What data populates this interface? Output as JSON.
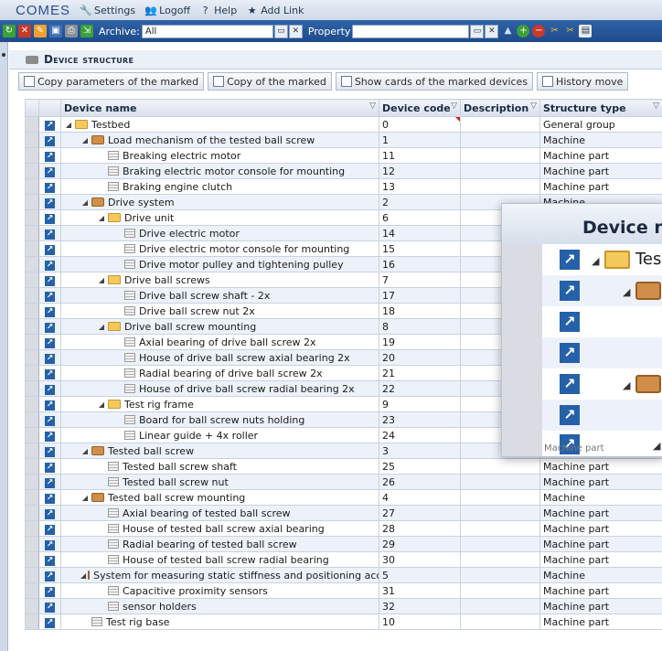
{
  "app": {
    "logo_text": "COMES",
    "menu": [
      {
        "label": "Settings",
        "icon": "wrench-icon"
      },
      {
        "label": "Logoff",
        "icon": "users-icon"
      },
      {
        "label": "Help",
        "icon": "help-icon"
      },
      {
        "label": "Add Link",
        "icon": "star-icon"
      }
    ]
  },
  "toolbar": {
    "archive_label": "Archive:",
    "archive_value": "All",
    "property_label": "Property",
    "property_value": ""
  },
  "section": {
    "title": "Device structure"
  },
  "actions": [
    {
      "label": "Copy parameters of the marked",
      "icon": "copy-icon"
    },
    {
      "label": "Copy of the marked",
      "icon": "copy-icon"
    },
    {
      "label": "Show cards of the marked devices",
      "icon": "print-icon"
    },
    {
      "label": "History move",
      "icon": "history-icon"
    }
  ],
  "grid": {
    "columns": [
      "Device name",
      "Device code",
      "Description",
      "Structure type"
    ],
    "rows": [
      {
        "name": "Testbed",
        "code": "0",
        "type": "General group",
        "level": 0,
        "kind": "folder",
        "expanded": true
      },
      {
        "name": "Load mechanism of the tested ball screw",
        "code": "1",
        "type": "Machine",
        "level": 1,
        "kind": "machine",
        "expanded": true
      },
      {
        "name": "Breaking electric motor",
        "code": "11",
        "type": "Machine part",
        "level": 2,
        "kind": "part"
      },
      {
        "name": "Braking electric motor console for mounting",
        "code": "12",
        "type": "Machine part",
        "level": 2,
        "kind": "part"
      },
      {
        "name": "Braking engine clutch",
        "code": "13",
        "type": "Machine part",
        "level": 2,
        "kind": "part"
      },
      {
        "name": "Drive system",
        "code": "2",
        "type": "Machine",
        "level": 1,
        "kind": "machine",
        "expanded": true
      },
      {
        "name": "Drive unit",
        "code": "6",
        "type": "",
        "level": 2,
        "kind": "folder",
        "expanded": true
      },
      {
        "name": "Drive electric motor",
        "code": "14",
        "type": "",
        "level": 3,
        "kind": "part"
      },
      {
        "name": "Drive electric motor console for mounting",
        "code": "15",
        "type": "",
        "level": 3,
        "kind": "part"
      },
      {
        "name": "Drive motor pulley and tightening pulley",
        "code": "16",
        "type": "",
        "level": 3,
        "kind": "part"
      },
      {
        "name": "Drive ball screws",
        "code": "7",
        "type": "",
        "level": 2,
        "kind": "folder",
        "expanded": true
      },
      {
        "name": "Drive ball screw shaft - 2x",
        "code": "17",
        "type": "",
        "level": 3,
        "kind": "part"
      },
      {
        "name": "Drive ball screw nut 2x",
        "code": "18",
        "type": "",
        "level": 3,
        "kind": "part"
      },
      {
        "name": "Drive ball screw mounting",
        "code": "8",
        "type": "",
        "level": 2,
        "kind": "folder",
        "expanded": true
      },
      {
        "name": "Axial bearing of drive ball screw 2x",
        "code": "19",
        "type": "",
        "level": 3,
        "kind": "part"
      },
      {
        "name": "House of drive ball screw axial bearing 2x",
        "code": "20",
        "type": "",
        "level": 3,
        "kind": "part"
      },
      {
        "name": "Radial bearing of drive ball screw 2x",
        "code": "21",
        "type": "",
        "level": 3,
        "kind": "part"
      },
      {
        "name": "House of drive ball screw radial bearing 2x",
        "code": "22",
        "type": "",
        "level": 3,
        "kind": "part"
      },
      {
        "name": "Test rig frame",
        "code": "9",
        "type": "",
        "level": 2,
        "kind": "folder",
        "expanded": true
      },
      {
        "name": "Board for ball screw nuts holding",
        "code": "23",
        "type": "",
        "level": 3,
        "kind": "part"
      },
      {
        "name": "Linear guide + 4x roller",
        "code": "24",
        "type": "",
        "level": 3,
        "kind": "part"
      },
      {
        "name": "Tested ball screw",
        "code": "3",
        "type": "Machine",
        "level": 1,
        "kind": "machine",
        "expanded": true
      },
      {
        "name": "Tested ball screw shaft",
        "code": "25",
        "type": "Machine part",
        "level": 2,
        "kind": "part"
      },
      {
        "name": "Tested ball screw nut",
        "code": "26",
        "type": "Machine part",
        "level": 2,
        "kind": "part"
      },
      {
        "name": "Tested ball screw mounting",
        "code": "4",
        "type": "Machine",
        "level": 1,
        "kind": "machine",
        "expanded": true
      },
      {
        "name": "Axial bearing of tested ball screw",
        "code": "27",
        "type": "Machine part",
        "level": 2,
        "kind": "part"
      },
      {
        "name": "House of tested ball screw axial bearing",
        "code": "28",
        "type": "Machine part",
        "level": 2,
        "kind": "part"
      },
      {
        "name": "Radial bearing of tested ball screw",
        "code": "29",
        "type": "Machine part",
        "level": 2,
        "kind": "part"
      },
      {
        "name": "House of tested ball screw radial bearing",
        "code": "30",
        "type": "Machine part",
        "level": 2,
        "kind": "part"
      },
      {
        "name": "System for measuring static stiffness and positioning accuracy",
        "code": "5",
        "type": "Machine",
        "level": 1,
        "kind": "machine",
        "expanded": true
      },
      {
        "name": "Capacitive proximity sensors",
        "code": "31",
        "type": "Machine part",
        "level": 2,
        "kind": "part"
      },
      {
        "name": "sensor holders",
        "code": "32",
        "type": "Machine part",
        "level": 2,
        "kind": "part"
      },
      {
        "name": "Test rig base",
        "code": "10",
        "type": "Machine part",
        "level": 1,
        "kind": "part"
      }
    ]
  },
  "zoom": {
    "header_text": "Device n",
    "row1_text": "Tes",
    "footer_text": "Machine part"
  },
  "colors": {
    "toolbar": "#1f4b8c",
    "link_icon": "#2561a8",
    "row_alt": "#edf2fa"
  }
}
